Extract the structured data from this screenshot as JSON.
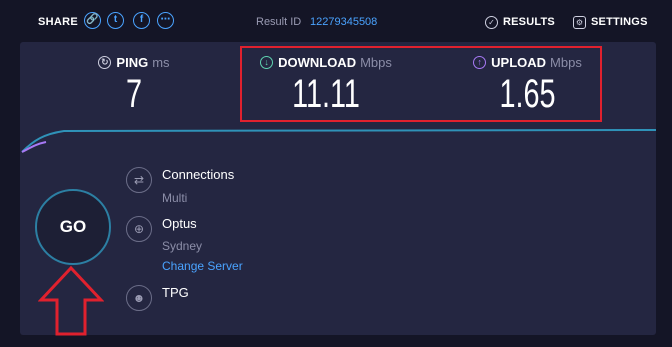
{
  "header": {
    "share_label": "SHARE",
    "share_icons": [
      "link-icon",
      "twitter-icon",
      "facebook-icon",
      "more-icon"
    ],
    "result_label": "Result ID",
    "result_id": "12279345508",
    "results_label": "RESULTS",
    "settings_label": "SETTINGS"
  },
  "metrics": {
    "ping": {
      "label": "PING",
      "unit": "ms",
      "value": "7"
    },
    "download": {
      "label": "DOWNLOAD",
      "unit": "Mbps",
      "value": "11.11"
    },
    "upload": {
      "label": "UPLOAD",
      "unit": "Mbps",
      "value": "1.65"
    }
  },
  "go_button": {
    "label": "GO"
  },
  "info": {
    "connections": {
      "title": "Connections",
      "value": "Multi"
    },
    "server": {
      "title": "Optus",
      "location": "Sydney",
      "change_link": "Change Server"
    },
    "provider": {
      "title": "TPG"
    }
  },
  "colors": {
    "accent_blue": "#4aa3ff",
    "download_green": "#5fd3b0",
    "upload_purple": "#a779f5",
    "highlight_red": "#e0212e",
    "panel_bg": "#242641",
    "page_bg": "#141526"
  }
}
